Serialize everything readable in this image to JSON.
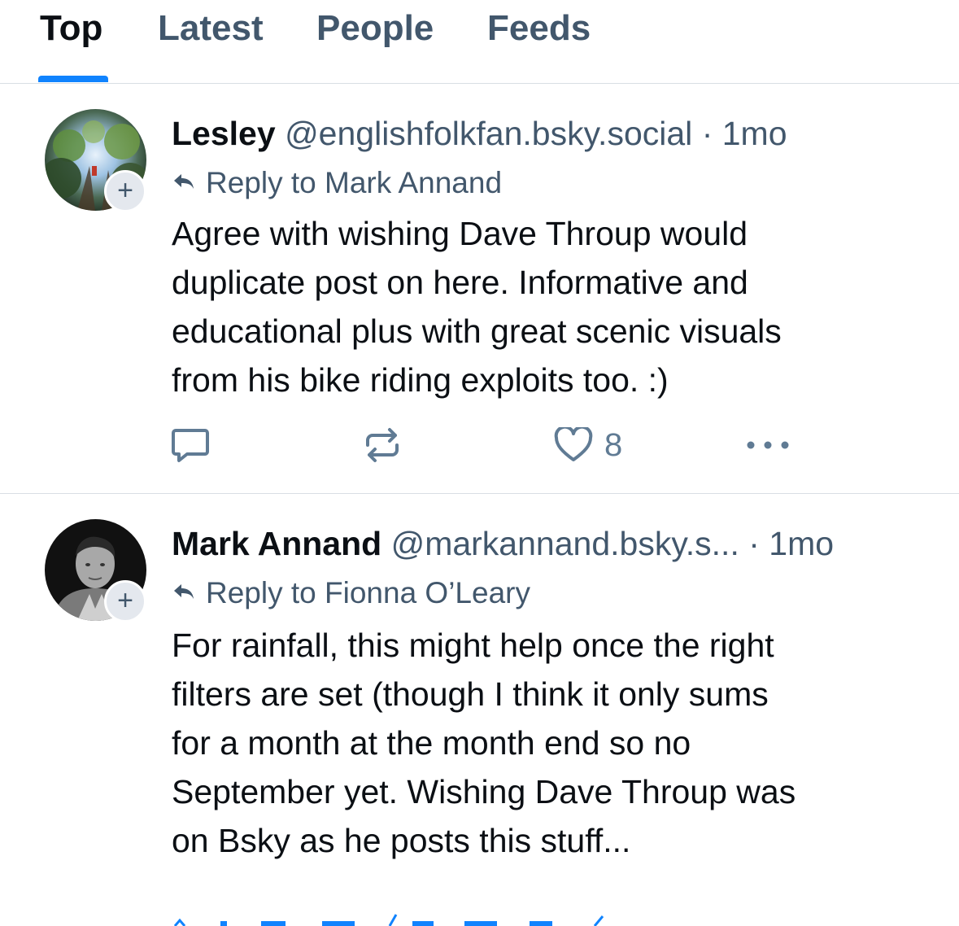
{
  "tabs": [
    {
      "label": "Top",
      "active": true
    },
    {
      "label": "Latest",
      "active": false
    },
    {
      "label": "People",
      "active": false
    },
    {
      "label": "Feeds",
      "active": false
    }
  ],
  "accent_color": "#1083fe",
  "posts": [
    {
      "author_name": "Lesley",
      "handle": "@englishfolkfan.bsky.social",
      "time": "· 1mo",
      "reply_to": "Reply to Mark Annand",
      "avatar_icon": "fisheye-trees-photo",
      "text_lines": [
        "Agree with wishing Dave Throup would",
        "duplicate post on here. Informative and",
        "educational plus with great scenic visuals",
        "from his bike riding exploits too. :)"
      ],
      "like_count": "8"
    },
    {
      "author_name": "Mark Annand",
      "handle": "@markannand.bsky.s...",
      "time": "· 1mo",
      "reply_to": "Reply to Fionna O’Leary",
      "avatar_icon": "man-portrait-bw-photo",
      "text_lines": [
        "For rainfall, this might help once the right",
        "filters are set (though I think it only sums",
        "for a month at the month end so no",
        "September yet. Wishing Dave Throup was",
        "on Bsky as he posts this stuff..."
      ]
    }
  ],
  "icons": {
    "follow": "plus-icon",
    "reply_arrow": "reply-arrow-icon",
    "comment": "comment-icon",
    "repost": "repost-icon",
    "like": "heart-icon",
    "more": "more-icon"
  },
  "follow_symbol": "+"
}
